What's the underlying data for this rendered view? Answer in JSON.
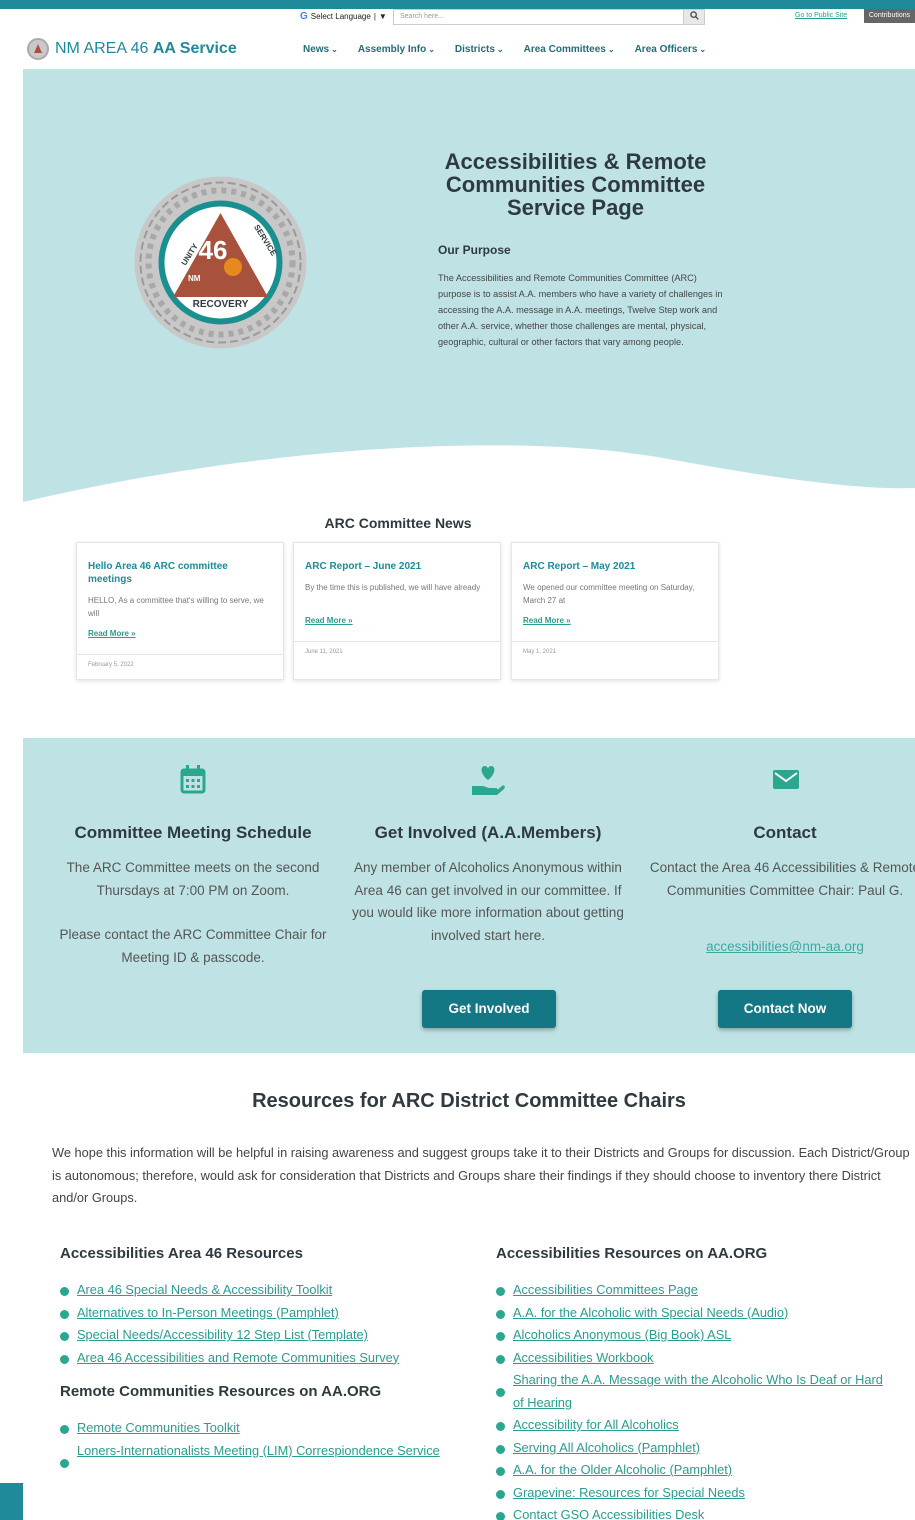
{
  "topbar": {
    "translate_label": "Select Language",
    "translate_arrow": "▼",
    "search_placeholder": "Search here...",
    "public_site_link": "Go to Public Site",
    "contributions_button": "Contributions"
  },
  "nav": {
    "logo_text_prefix": "NM AREA 46 ",
    "logo_text_bold": "AA Service",
    "menu": [
      {
        "label": "News"
      },
      {
        "label": "Assembly Info"
      },
      {
        "label": "Districts"
      },
      {
        "label": "Area Committees"
      },
      {
        "label": "Area Officers"
      }
    ]
  },
  "hero": {
    "badge": {
      "number": "46",
      "top_left": "UNITY",
      "top_right": "SERVICE",
      "bottom": "RECOVERY",
      "state": "NM"
    },
    "title": "Accessibilities & Remote Communities Committee Service Page",
    "purpose_heading": "Our Purpose",
    "purpose_text": "The Accessibilities and Remote Communities Committee (ARC) purpose is to assist A.A. members who have a variety of challenges in accessing the A.A. message in A.A. meetings, Twelve Step work and other A.A. service, whether those challenges are mental, physical, geographic, cultural or other factors that vary among people."
  },
  "news": {
    "heading": "ARC Committee News",
    "cards": [
      {
        "title": "Hello Area 46 ARC committee meetings",
        "excerpt": "HELLO, As a committee that's willing to serve, we will",
        "read_more": "Read More »",
        "date": "February 5, 2022"
      },
      {
        "title": "ARC Report – June 2021",
        "excerpt": "By the time this is published, we will have already",
        "read_more": "Read More »",
        "date": "June 11, 2021"
      },
      {
        "title": "ARC Report – May 2021",
        "excerpt": "We opened our committee meeting on Saturday, March 27 at",
        "read_more": "Read More »",
        "date": "May 1, 2021"
      }
    ]
  },
  "info": {
    "schedule": {
      "icon": "calendar-icon",
      "heading": "Committee Meeting Schedule",
      "text1": "The ARC Committee meets on the second Thursdays at 7:00 PM on Zoom.",
      "text2": "Please contact the ARC Committee Chair for Meeting ID & passcode."
    },
    "involved": {
      "icon": "heart-hand-icon",
      "heading": "Get Involved (A.A.Members)",
      "text": "Any member of Alcoholics Anonymous within Area 46 can get involved in our committee. If you would like more information about getting involved start here.",
      "button": "Get Involved"
    },
    "contact": {
      "icon": "envelope-icon",
      "heading": "Contact",
      "text": "Contact the Area 46 Accessibilities & Remote Communities Committee Chair: Paul G.",
      "email": "accessibilities@nm-aa.org",
      "button": "Contact Now"
    }
  },
  "resources": {
    "heading": "Resources for ARC District Committee Chairs",
    "intro": "We hope this information will be helpful in raising awareness and suggest groups take it to their Districts and Groups for discussion. Each District/Group is autonomous; therefore, would ask for consideration that Districts and Groups share their findings if they should choose to inventory there District and/or Groups.",
    "area46_heading": "Accessibilities Area 46 Resources",
    "area46_links": [
      "Area 46 Special Needs & Accessibility Toolkit",
      "Alternatives to In-Person Meetings (Pamphlet)",
      "Special Needs/Accessibility 12 Step List (Template)",
      "Area 46 Accessibilities and Remote Communities Survey"
    ],
    "remote_heading": "Remote Communities Resources on AA.ORG",
    "remote_links": [
      "Remote Communities Toolkit",
      "Loners-Internationalists Meeting (LIM) Correspiondence Service"
    ],
    "aaorg_heading": "Accessibilities Resources on AA.ORG",
    "aaorg_links": [
      "Accessibilities Committees Page",
      "A.A. for the Alcoholic with Special Needs (Audio)",
      "Alcoholics Anonymous (Big Book) ASL",
      "Accessibilities Workbook",
      "Sharing the A.A. Message with the Alcoholic Who Is Deaf or Hard of Hearing",
      "Accessibility for All Alcoholics",
      "Serving All Alcoholics (Pamphlet)",
      "A.A. for the Older Alcoholic (Pamphlet)",
      "Grapevine: Resources for Special Needs",
      "Contact GSO Accessibilities Desk"
    ]
  },
  "colors": {
    "teal_dark": "#147785",
    "teal_accent": "#1e8a9a",
    "band_bg": "#bfe3e5",
    "link_green": "#2a9d8f"
  }
}
